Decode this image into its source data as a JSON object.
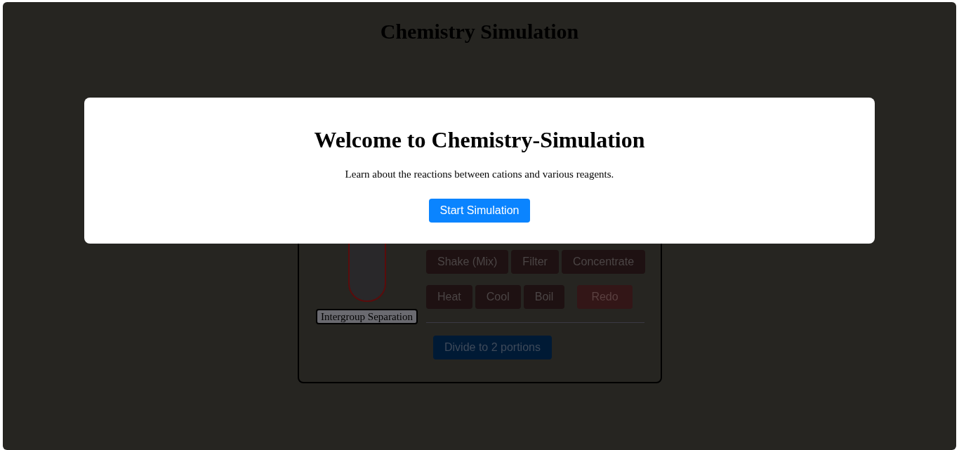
{
  "page_title": "Chemistry Simulation",
  "test_tube": {
    "label": "Intergroup Separation"
  },
  "action_rows": [
    [
      {
        "label": "Shake (Mix)",
        "kind": "action"
      },
      {
        "label": "Filter",
        "kind": "action"
      },
      {
        "label": "Concentrate",
        "kind": "action"
      }
    ],
    [
      {
        "label": "Heat",
        "kind": "action"
      },
      {
        "label": "Cool",
        "kind": "action"
      },
      {
        "label": "Boil",
        "kind": "action"
      },
      {
        "label": "Redo",
        "kind": "reset"
      }
    ]
  ],
  "divide_button": {
    "label": "Divide to 2 portions",
    "kind": "primary"
  },
  "modal": {
    "heading": "Welcome to Chemistry-Simulation",
    "text": "Learn about the reactions between cations and various reagents.",
    "button": "Start Simulation"
  }
}
